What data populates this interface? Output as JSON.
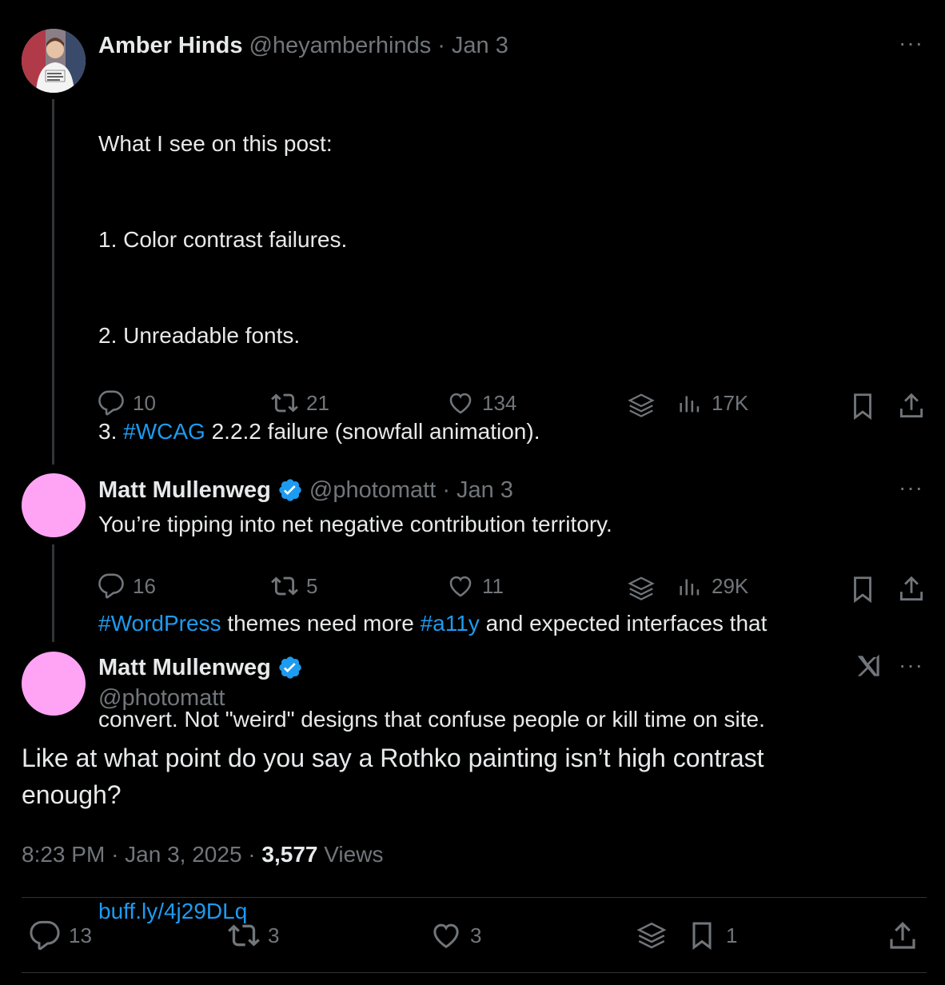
{
  "tweets": [
    {
      "name": "Amber Hinds",
      "handle": "@heyamberhinds",
      "sep": "·",
      "date": "Jan 3",
      "lines": [
        "What I see on this post:",
        "1. Color contrast failures.",
        "2. Unreadable fonts.",
        "3. ",
        "#WCAG",
        " 2.2.2 failure (snowfall animation).",
        "#WordPress",
        " themes need more ",
        "#a11y",
        " and expected interfaces that",
        "convert. Not \"weird\" designs that confuse people or kill time on site.",
        "buff.ly/4j29DLq"
      ],
      "replies": "10",
      "reposts": "21",
      "likes": "134",
      "views": "17K"
    },
    {
      "name": "Matt Mullenweg",
      "handle": "@photomatt",
      "sep": "·",
      "date": "Jan 3",
      "text": "You’re tipping into net negative contribution territory.",
      "replies": "16",
      "reposts": "5",
      "likes": "11",
      "views": "29K"
    }
  ],
  "main": {
    "name": "Matt Mullenweg",
    "handle": "@photomatt",
    "text": "Like at what point do you say a Rothko painting isn’t high contrast enough?",
    "time": "8:23 PM",
    "sep1": "·",
    "date": "Jan 3, 2025",
    "sep2": "·",
    "views_count": "3,577",
    "views_label": "Views",
    "replies": "13",
    "reposts": "3",
    "likes": "3",
    "bookmarks": "1"
  },
  "more_label": "···",
  "colors": {
    "accent": "#1d9bf0",
    "avatar_pink": "#ffa4f5",
    "muted": "#71767b"
  }
}
